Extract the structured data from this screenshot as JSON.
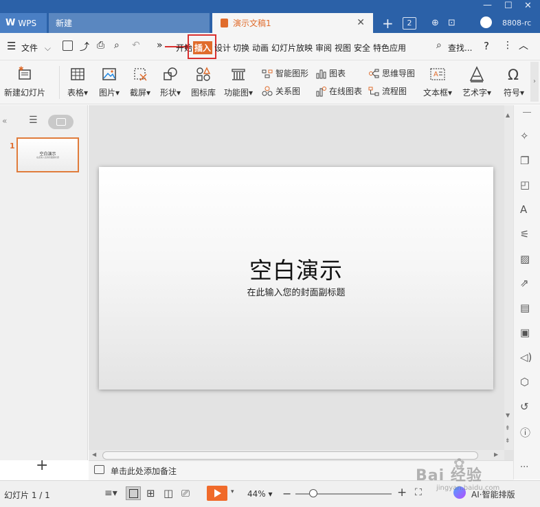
{
  "titlebar": {
    "tabs": [
      {
        "label": "WPS"
      },
      {
        "label": "新建"
      },
      {
        "label": "演示文稿1"
      }
    ],
    "tab_count": "2",
    "user_id": "8808-rc"
  },
  "menu": {
    "file_label": "文件",
    "more_arrow": "»",
    "items": [
      "开始",
      "插入",
      "设计",
      "切换",
      "动画",
      "幻灯片放映",
      "审阅",
      "视图",
      "安全",
      "特色应用"
    ],
    "search_label": "查找...",
    "help_label": "?",
    "more_label": "⋮"
  },
  "ribbon": {
    "large_items": [
      "新建幻灯片",
      "表格",
      "图片",
      "截屏",
      "形状",
      "图标库",
      "功能图"
    ],
    "small_items": [
      "智能图形",
      "关系图",
      "图表",
      "在线图表",
      "思维导图",
      "流程图"
    ],
    "right_items": [
      "文本框",
      "艺术字",
      "符号"
    ]
  },
  "slides_panel": {
    "slide_number": "1",
    "thumb_title": "空白演示",
    "thumb_subtitle": "在此输入您的封面副标题"
  },
  "slide": {
    "title": "空白演示",
    "subtitle": "在此输入您的封面副标题"
  },
  "notes": {
    "placeholder": "单击此处添加备注"
  },
  "status": {
    "slide_info": "幻灯片 1 / 1",
    "zoom": "44%",
    "ai_label": "AI·智能排版"
  },
  "watermark": {
    "text": "Bai 经验",
    "sub": "jingyan.baidu.com"
  },
  "colors": {
    "accent": "#e06c2c",
    "titlebar": "#2b61a8",
    "highlight_box": "#d9302f"
  }
}
